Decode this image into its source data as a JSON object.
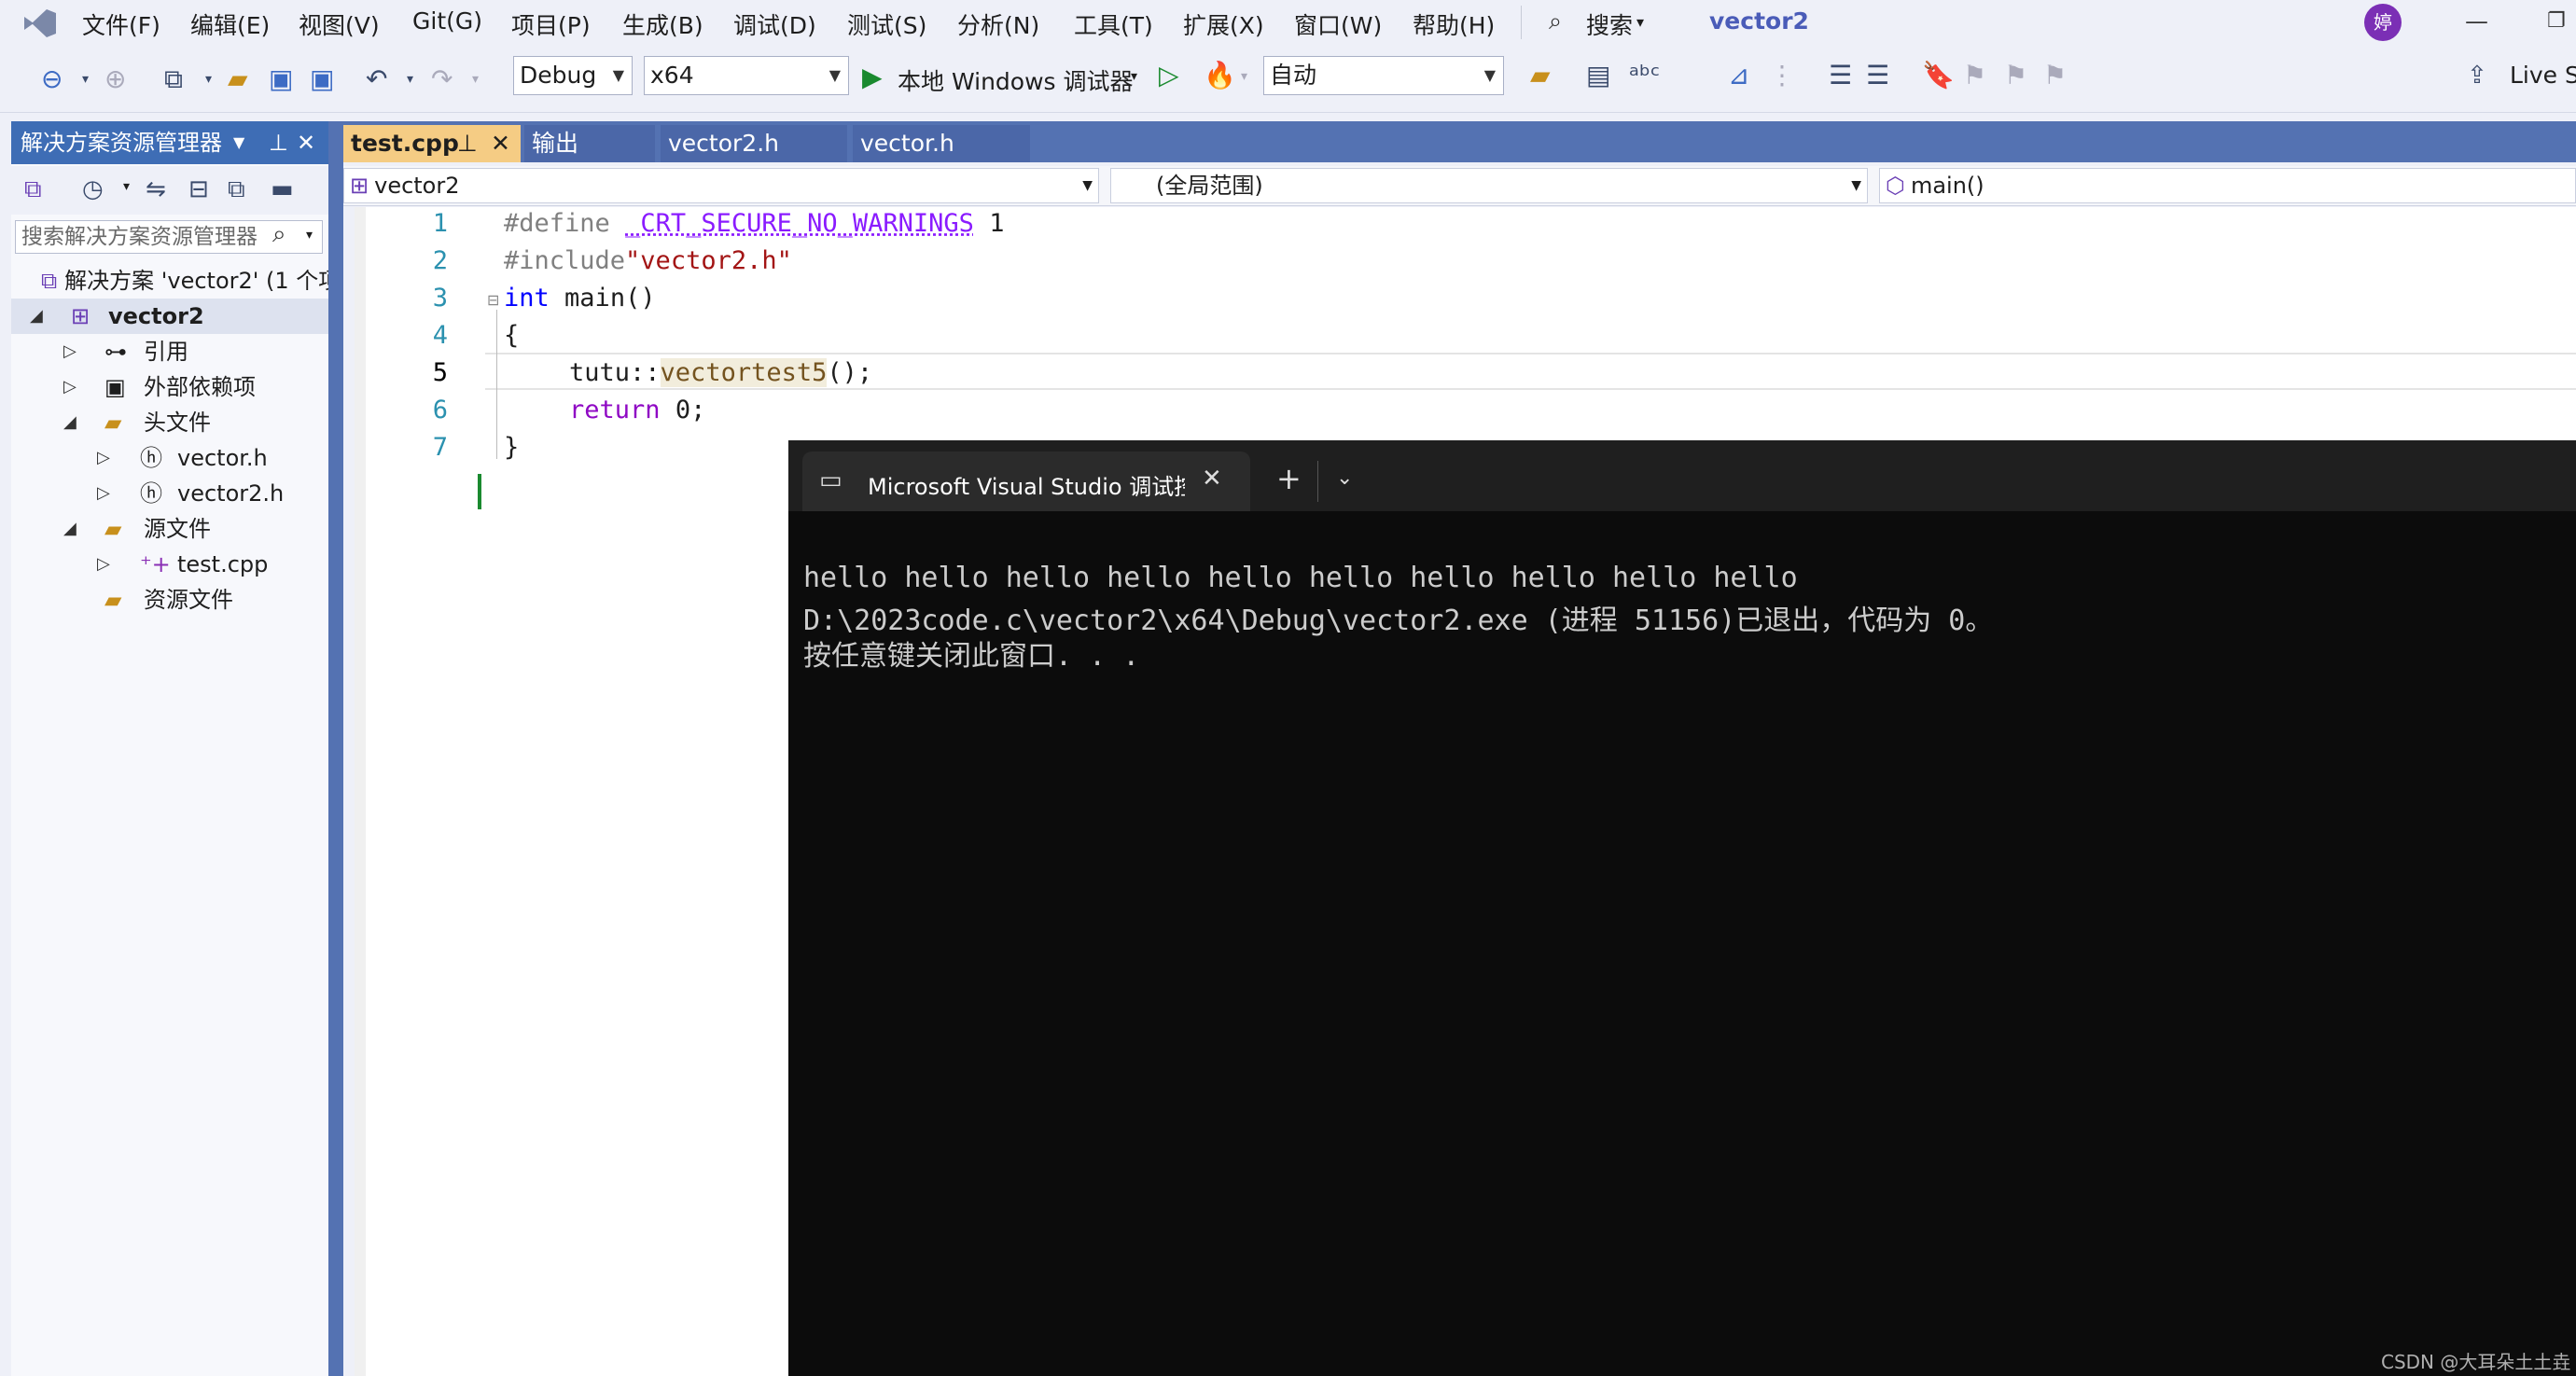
{
  "menu": {
    "items": [
      "文件(F)",
      "编辑(E)",
      "视图(V)",
      "Git(G)",
      "项目(P)",
      "生成(B)",
      "调试(D)",
      "测试(S)",
      "分析(N)",
      "工具(T)",
      "扩展(X)",
      "窗口(W)",
      "帮助(H)"
    ],
    "search_label": "搜索",
    "solution_title": "vector2",
    "avatar_initial": "婷"
  },
  "toolbar": {
    "config": "Debug",
    "platform": "x64",
    "run_label": "本地 Windows 调试器",
    "mode": "自动",
    "live_share": "Live Sh"
  },
  "solution_explorer": {
    "title": "解决方案资源管理器",
    "search_placeholder": "搜索解决方案资源管理器",
    "solution_label": "解决方案 'vector2' (1 个项",
    "project": "vector2",
    "references": "引用",
    "external_deps": "外部依赖项",
    "headers_folder": "头文件",
    "header1": "vector.h",
    "header2": "vector2.h",
    "sources_folder": "源文件",
    "source1": "test.cpp",
    "resources_folder": "资源文件"
  },
  "editor": {
    "tabs": [
      "test.cpp",
      "输出",
      "vector2.h",
      "vector.h"
    ],
    "nav_project": "vector2",
    "nav_scope": "(全局范围)",
    "nav_member": "main()",
    "line_numbers": [
      "1",
      "2",
      "3",
      "4",
      "5",
      "6",
      "7"
    ],
    "lines": {
      "l1_kw": "#define",
      "l1_macro": "_CRT_SECURE_NO_WARNINGS",
      "l1_val": "1",
      "l2_kw": "#include",
      "l2_str": "\"vector2.h\"",
      "l3_type": "int",
      "l3_rest": "main()",
      "l4": "{",
      "l5_ns": "tutu::",
      "l5_fn": "vectortest5",
      "l5_rest": "();",
      "l6_kw": "return",
      "l6_rest": "0;",
      "l7": "}"
    }
  },
  "console": {
    "tab_title": "Microsoft Visual Studio 调试控",
    "output": [
      "hello hello hello hello hello hello hello hello hello hello",
      "D:\\2023code.c\\vector2\\x64\\Debug\\vector2.exe (进程 51156)已退出，代码为 0。",
      "按任意键关闭此窗口. . ."
    ]
  },
  "watermark": "CSDN @大耳朵土土垚",
  "colors": {
    "accent": "#3e6db5",
    "tab_active": "#f5cc84",
    "keyword": "#0000ff",
    "macro": "#8a1bff",
    "string": "#a31515",
    "preproc": "#808080"
  }
}
